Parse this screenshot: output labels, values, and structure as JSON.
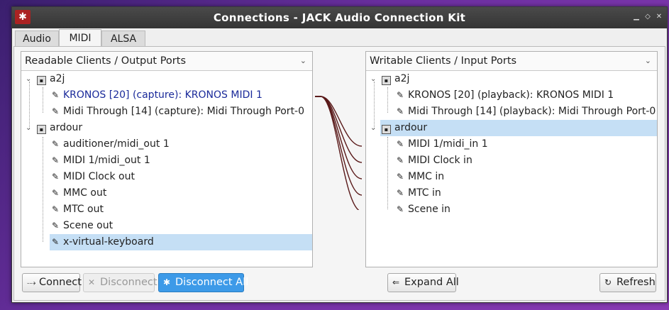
{
  "window": {
    "title": "Connections - JACK Audio Connection Kit",
    "app_icon": "jack-icon"
  },
  "tabs": [
    {
      "label": "Audio",
      "active": false
    },
    {
      "label": "MIDI",
      "active": true
    },
    {
      "label": "ALSA",
      "active": false
    }
  ],
  "left_panel": {
    "header": "Readable Clients / Output Ports",
    "clients": [
      {
        "name": "a2j",
        "ports": [
          {
            "label": "KRONOS [20] (capture): KRONOS MIDI 1"
          },
          {
            "label": "Midi Through [14] (capture): Midi Through Port-0"
          }
        ]
      },
      {
        "name": "ardour",
        "ports": [
          {
            "label": "auditioner/midi_out 1"
          },
          {
            "label": "MIDI 1/midi_out 1"
          },
          {
            "label": "MIDI Clock out"
          },
          {
            "label": "MMC out"
          },
          {
            "label": "MTC out"
          },
          {
            "label": "Scene out"
          },
          {
            "label": "x-virtual-keyboard"
          }
        ]
      }
    ]
  },
  "right_panel": {
    "header": "Writable Clients / Input Ports",
    "clients": [
      {
        "name": "a2j",
        "ports": [
          {
            "label": "KRONOS [20] (playback): KRONOS MIDI 1"
          },
          {
            "label": "Midi Through [14] (playback): Midi Through Port-0"
          }
        ]
      },
      {
        "name": "ardour",
        "ports": [
          {
            "label": "MIDI 1/midi_in 1"
          },
          {
            "label": "MIDI Clock in"
          },
          {
            "label": "MMC in"
          },
          {
            "label": "MTC in"
          },
          {
            "label": "Scene in"
          }
        ]
      }
    ]
  },
  "buttons": {
    "connect": "Connect",
    "disconnect": "Disconnect",
    "disconnect_all": "Disconnect All",
    "expand_all": "Expand All",
    "refresh": "Refresh"
  },
  "colors": {
    "accent": "#3d9ae8",
    "selection": "#c5dff5",
    "connection_line": "#5a1a1a",
    "connected_port_text": "#1a2a9a"
  }
}
